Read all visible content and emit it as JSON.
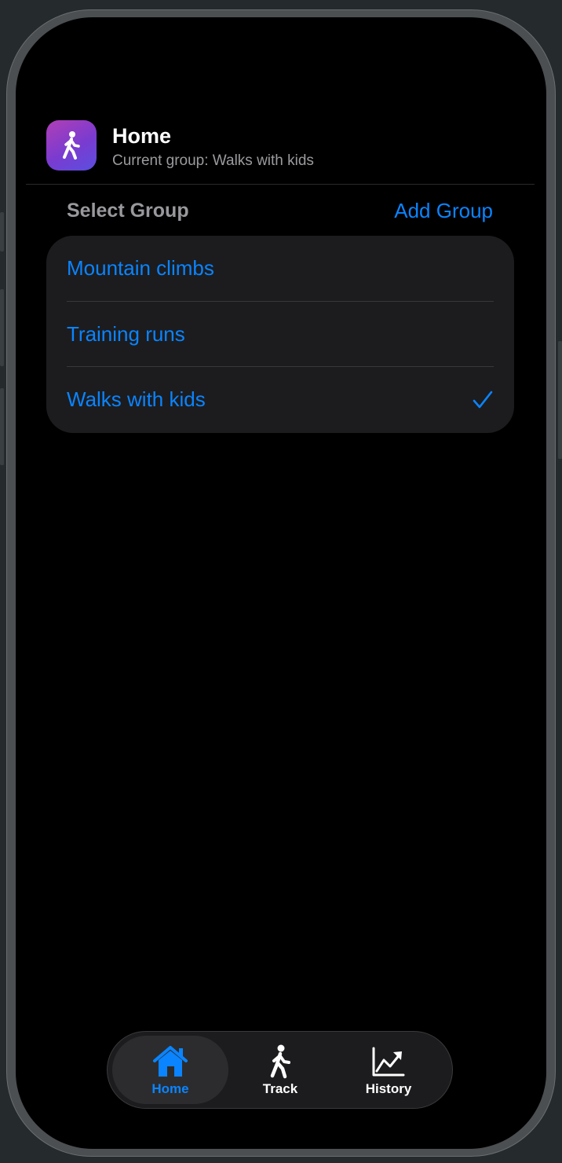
{
  "header": {
    "title": "Home",
    "subtitle": "Current group: Walks with kids",
    "app_icon": "figure-walk-icon"
  },
  "section": {
    "label": "Select Group",
    "add_button": "Add Group"
  },
  "groups": [
    {
      "label": "Mountain climbs",
      "selected": false
    },
    {
      "label": "Training runs",
      "selected": false
    },
    {
      "label": "Walks with kids",
      "selected": true
    }
  ],
  "tabs": [
    {
      "label": "Home",
      "icon": "house-icon",
      "active": true
    },
    {
      "label": "Track",
      "icon": "figure-walk-icon",
      "active": false
    },
    {
      "label": "History",
      "icon": "chart-line-icon",
      "active": false
    }
  ],
  "colors": {
    "accent": "#0a84ff",
    "background": "#000000",
    "card": "#1c1c1e",
    "secondary_text": "#98989d"
  }
}
